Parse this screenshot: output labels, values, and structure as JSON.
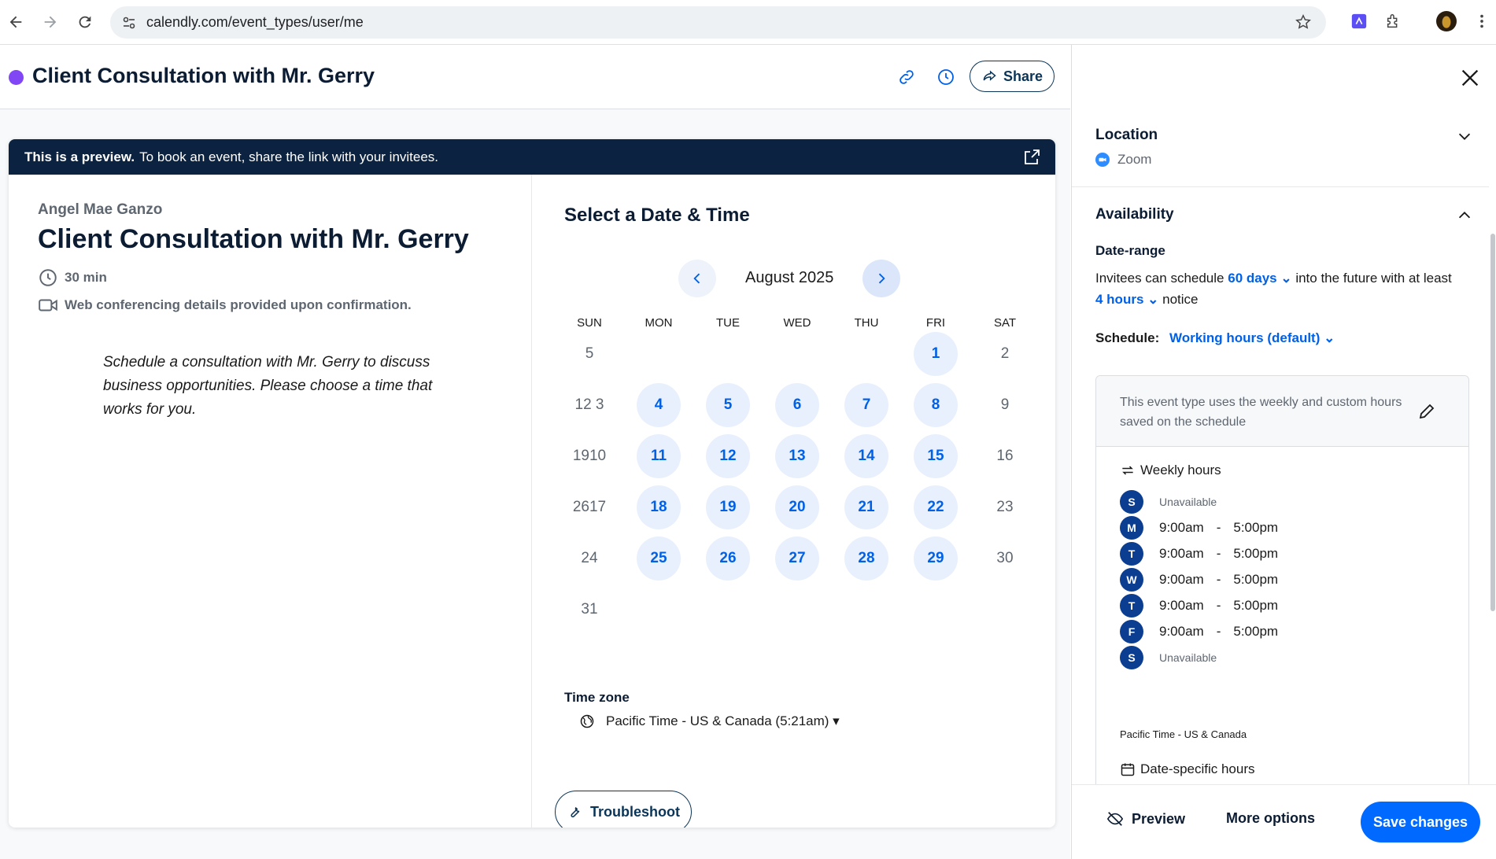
{
  "browser": {
    "url": "calendly.com/event_types/user/me"
  },
  "header": {
    "title": "Client Consultation with Mr. Gerry",
    "share_label": "Share",
    "accent": "#8247f5"
  },
  "preview": {
    "banner_bold": "This is a preview.",
    "banner_text": "To book an event, share the link with your invitees.",
    "host": "Angel Mae Ganzo",
    "title": "Client Consultation with Mr. Gerry",
    "duration": "30 min",
    "conferencing": "Web conferencing details provided upon confirmation.",
    "description": "Schedule a consultation with Mr. Gerry to discuss business opportunities. Please choose a time that works for you.",
    "select_title": "Select a Date & Time",
    "month": "August 2025",
    "weekdays": [
      "SUN",
      "MON",
      "TUE",
      "WED",
      "THU",
      "FRI",
      "SAT"
    ],
    "weeks": [
      [
        {
          "t": "5",
          "a": false
        },
        {
          "t": "",
          "a": false
        },
        {
          "t": "",
          "a": false
        },
        {
          "t": "",
          "a": false
        },
        {
          "t": "",
          "a": false
        },
        {
          "t": "1",
          "a": true
        },
        {
          "t": "2",
          "a": false
        }
      ],
      [
        {
          "t": "12 3",
          "a": false
        },
        {
          "t": "4",
          "a": true
        },
        {
          "t": "5",
          "a": true
        },
        {
          "t": "6",
          "a": true
        },
        {
          "t": "7",
          "a": true
        },
        {
          "t": "8",
          "a": true
        },
        {
          "t": "9",
          "a": false
        }
      ],
      [
        {
          "t": "1910",
          "a": false
        },
        {
          "t": "11",
          "a": true
        },
        {
          "t": "12",
          "a": true
        },
        {
          "t": "13",
          "a": true
        },
        {
          "t": "14",
          "a": true
        },
        {
          "t": "15",
          "a": true
        },
        {
          "t": "16",
          "a": false
        }
      ],
      [
        {
          "t": "2617",
          "a": false
        },
        {
          "t": "18",
          "a": true
        },
        {
          "t": "19",
          "a": true
        },
        {
          "t": "20",
          "a": true
        },
        {
          "t": "21",
          "a": true
        },
        {
          "t": "22",
          "a": true
        },
        {
          "t": "23",
          "a": false
        }
      ],
      [
        {
          "t": "24",
          "a": false
        },
        {
          "t": "25",
          "a": true
        },
        {
          "t": "26",
          "a": true
        },
        {
          "t": "27",
          "a": true
        },
        {
          "t": "28",
          "a": true
        },
        {
          "t": "29",
          "a": true
        },
        {
          "t": "30",
          "a": false
        }
      ],
      [
        {
          "t": "31",
          "a": false
        },
        {
          "t": "",
          "a": false
        },
        {
          "t": "",
          "a": false
        },
        {
          "t": "",
          "a": false
        },
        {
          "t": "",
          "a": false
        },
        {
          "t": "",
          "a": false
        },
        {
          "t": "",
          "a": false
        }
      ]
    ],
    "tz_label": "Time zone",
    "tz_value": "Pacific Time - US & Canada (5:21am) ▾",
    "troubleshoot_label": "Troubleshoot"
  },
  "sidebar": {
    "location_title": "Location",
    "location_value": "Zoom",
    "availability_title": "Availability",
    "date_range_title": "Date-range",
    "range_prefix": "Invitees can schedule",
    "range_days": "60 days",
    "range_mid": "into the future with at least",
    "range_hours": "4 hours",
    "range_suffix": "notice",
    "schedule_label": "Schedule:",
    "schedule_value": "Working hours (default)",
    "schedule_note": "This event type uses the weekly and custom hours saved on the schedule",
    "weekly_title": "Weekly hours",
    "days": [
      {
        "letter": "S",
        "unavailable": "Unavailable",
        "start": "",
        "sep": "",
        "end": ""
      },
      {
        "letter": "M",
        "unavailable": "",
        "start": "9:00am",
        "sep": "-",
        "end": "5:00pm"
      },
      {
        "letter": "T",
        "unavailable": "",
        "start": "9:00am",
        "sep": "-",
        "end": "5:00pm"
      },
      {
        "letter": "W",
        "unavailable": "",
        "start": "9:00am",
        "sep": "-",
        "end": "5:00pm"
      },
      {
        "letter": "T",
        "unavailable": "",
        "start": "9:00am",
        "sep": "-",
        "end": "5:00pm"
      },
      {
        "letter": "F",
        "unavailable": "",
        "start": "9:00am",
        "sep": "-",
        "end": "5:00pm"
      },
      {
        "letter": "S",
        "unavailable": "Unavailable",
        "start": "",
        "sep": "",
        "end": ""
      }
    ],
    "timezone": "Pacific Time - US & Canada",
    "date_specific_title": "Date-specific hours",
    "preview_label": "Preview",
    "more_options_label": "More options",
    "save_label": "Save changes"
  }
}
